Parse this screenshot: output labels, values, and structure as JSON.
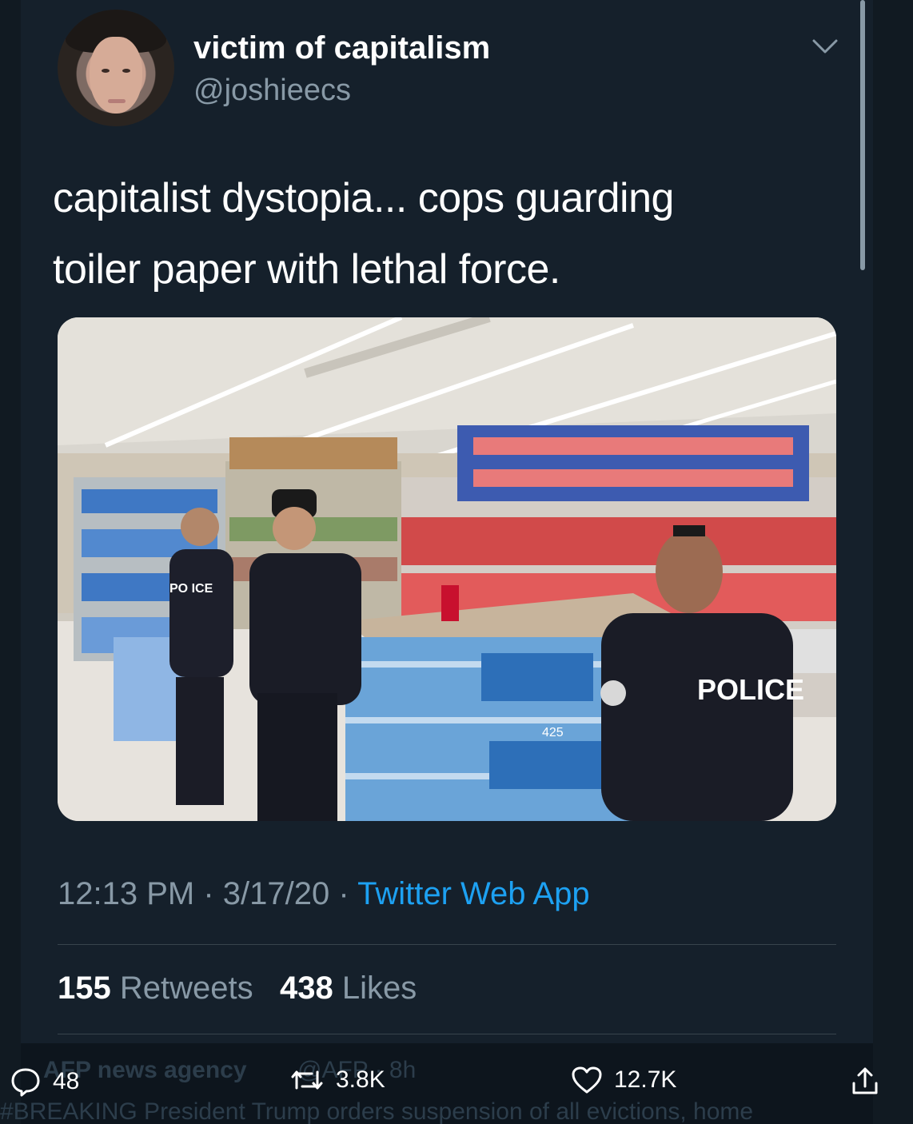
{
  "tweet": {
    "display_name": "victim of capitalism",
    "handle": "@joshieecs",
    "text_line1": "capitalist dystopia... cops guarding",
    "text_line2": "toiler paper with lethal force.",
    "time": "12:13 PM",
    "date": "3/17/20",
    "separator": "·",
    "source": "Twitter Web App",
    "retweets_count": "155",
    "retweets_label": "Retweets",
    "likes_count": "438",
    "likes_label": "Likes",
    "photo_text": {
      "police_back": "POLICE",
      "police_partial": "PO ICE",
      "pack_count": "425"
    }
  },
  "underlying_tweet": {
    "account": "AFP news agency",
    "account_handle_partial": "@AFP · 8h",
    "text": "#BREAKING President Trump orders suspension of all evictions, home",
    "replies": "48",
    "retweets": "3.8K",
    "likes": "12.7K"
  },
  "icons": [
    "chevron-down-icon",
    "reply-icon",
    "retweet-icon",
    "like-icon",
    "share-icon"
  ],
  "colors": {
    "background": "#15202b",
    "accent": "#1da1f2",
    "secondary_text": "#8899a6"
  }
}
